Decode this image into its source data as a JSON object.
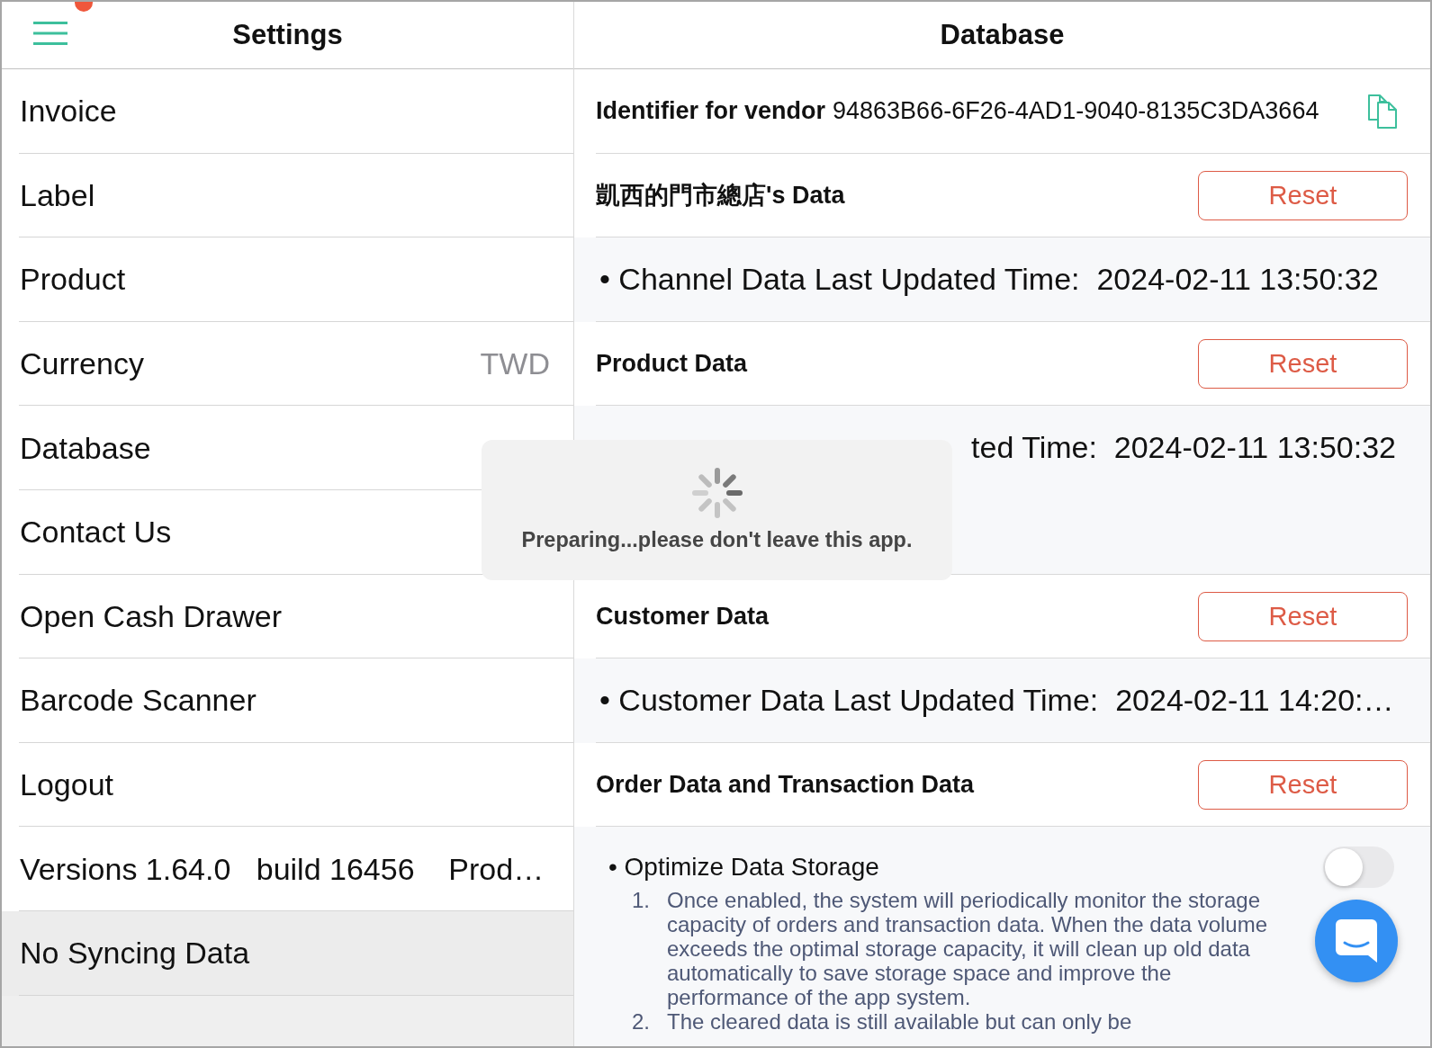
{
  "sidebar": {
    "title": "Settings",
    "items": [
      {
        "label": "Invoice",
        "selected": false
      },
      {
        "label": "Label",
        "selected": false
      },
      {
        "label": "Product",
        "selected": false
      },
      {
        "label": "Currency",
        "value": "TWD",
        "selected": false
      },
      {
        "label": "Database",
        "selected": false
      },
      {
        "label": "Contact Us",
        "selected": false
      },
      {
        "label": "Open Cash Drawer",
        "selected": false
      },
      {
        "label": "Barcode Scanner",
        "selected": false
      },
      {
        "label": "Logout",
        "selected": false
      },
      {
        "label": "Versions 1.64.0   build 16456    Prod…",
        "selected": false
      },
      {
        "label": "No Syncing Data",
        "selected": true
      }
    ]
  },
  "detail": {
    "title": "Database",
    "identifier": {
      "label": "Identifier for vendor",
      "value": "94863B66-6F26-4AD1-9040-8135C3DA3664"
    },
    "sections": [
      {
        "title": "凱西的門市總店's Data",
        "button": "Reset",
        "details": [
          {
            "kind": "plain",
            "text": "• Channel Data Last Updated Time:  2024-02-11 13:50:32"
          }
        ]
      },
      {
        "title": "Product Data",
        "button": "Reset",
        "details": [
          {
            "kind": "obscured",
            "text": "ted Time:  2024-02-11 13:50:32"
          }
        ]
      },
      {
        "title": "Customer Data",
        "button": "Reset",
        "details": [
          {
            "kind": "plain",
            "text": "• Customer Data Last Updated Time:  2024-02-11 14:20:…"
          }
        ]
      },
      {
        "title": "Order Data and Transaction Data",
        "button": "Reset"
      }
    ],
    "storage": {
      "title": "• Optimize Data Storage",
      "on": false,
      "notes": [
        {
          "number": "1.",
          "text": "Once enabled, the system will periodically monitor the storage capacity of orders and transaction data. When the data volume exceeds the optimal storage capacity, it will clean up old data automatically to save storage space and improve the performance of the app system."
        },
        {
          "number": "2.",
          "text": "The cleared data is still available but can only be"
        }
      ]
    }
  },
  "loading_overlay": {
    "message": "Preparing...please don't leave this app."
  }
}
